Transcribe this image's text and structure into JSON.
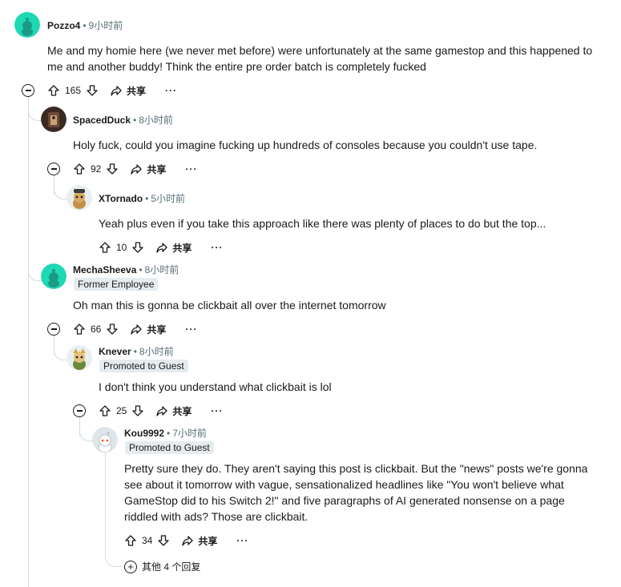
{
  "comments": [
    {
      "author": "Pozzo4",
      "time": "9小时前",
      "flair": "",
      "body_lines": [
        "Me and my homie here (we never met before) were unfortunately at the same gamestop and this happened to",
        "me and another buddy! Think the entire pre order batch is completely fucked"
      ],
      "votes": "165"
    },
    {
      "author": "SpacedDuck",
      "time": "8小时前",
      "flair": "",
      "body_lines": [
        "Holy fuck, could you imagine fucking up hundreds of consoles because you couldn't use tape."
      ],
      "votes": "92"
    },
    {
      "author": "XTornado",
      "time": "5小时前",
      "flair": "",
      "body_lines": [
        "Yeah plus even if you take this approach like there was plenty of places to do but the top..."
      ],
      "votes": "10"
    },
    {
      "author": "MechaSheeva",
      "time": "8小时前",
      "flair": "Former Employee",
      "body_lines": [
        "Oh man this is gonna be clickbait all over the internet tomorrow"
      ],
      "votes": "66"
    },
    {
      "author": "Knever",
      "time": "8小时前",
      "flair": "Promoted to Guest",
      "body_lines": [
        "I don't think you understand what clickbait is lol"
      ],
      "votes": "25"
    },
    {
      "author": "Kou9992",
      "time": "7小时前",
      "flair": "Promoted to Guest",
      "body_lines": [
        "Pretty sure they do. They aren't saying this post is clickbait. But the \"news\" posts we're gonna",
        "see about it tomorrow with vague, sensationalized headlines like \"You won't believe what",
        "GameStop did to his Switch 2!\" and five paragraphs of AI generated nonsense on a page",
        "riddled with ads? Those are clickbait."
      ],
      "votes": "34"
    }
  ],
  "share_label": "共享",
  "more_label": "···",
  "more_replies_label": "其他 4 个回复",
  "icons": {
    "upvote": "upvote-icon",
    "downvote": "downvote-icon",
    "share": "share-icon",
    "collapse": "collapse-icon",
    "expand": "plus-icon"
  },
  "colors": {
    "avatar_green": "#1fd8b5",
    "meta_gray": "#576f76",
    "flair_bg": "#e5ebee",
    "thread_line": "#d7dadc"
  }
}
